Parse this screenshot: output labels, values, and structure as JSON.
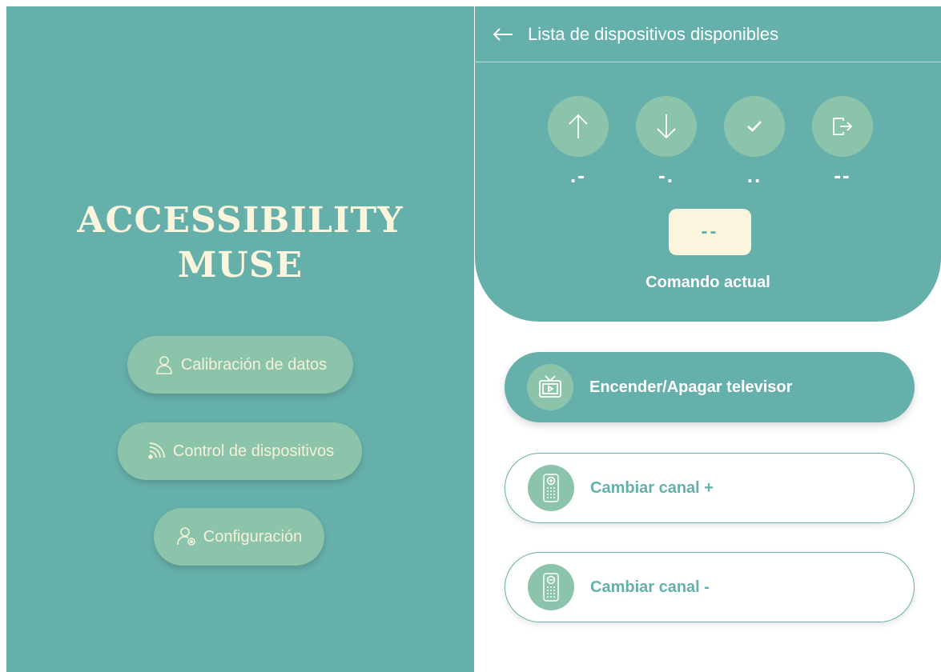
{
  "left": {
    "title_line1": "ACCESSIBILITY",
    "title_line2": "MUSE",
    "menu": [
      {
        "label": "Calibración de datos",
        "icon": "user-icon"
      },
      {
        "label": "Control de dispositivos",
        "icon": "wifi-signal-icon"
      },
      {
        "label": "Configuración",
        "icon": "user-settings-icon"
      }
    ]
  },
  "right": {
    "header_title": "Lista de dispositivos disponibles",
    "nav_buttons": [
      {
        "icon": "arrow-up-icon",
        "code": ".-"
      },
      {
        "icon": "arrow-down-icon",
        "code": "-."
      },
      {
        "icon": "check-icon",
        "code": ".."
      },
      {
        "icon": "logout-icon",
        "code": "--"
      }
    ],
    "current_command_value": "--",
    "current_command_label": "Comando actual",
    "commands": [
      {
        "label": "Encender/Apagar televisor",
        "icon": "tv-icon",
        "active": true
      },
      {
        "label": "Cambiar canal +",
        "icon": "remote-plus-icon",
        "active": false
      },
      {
        "label": "Cambiar canal -",
        "icon": "remote-minus-icon",
        "active": false
      }
    ]
  },
  "colors": {
    "teal": "#66b0ab",
    "mint": "#8cc4ab",
    "cream": "#fbf5dd"
  }
}
